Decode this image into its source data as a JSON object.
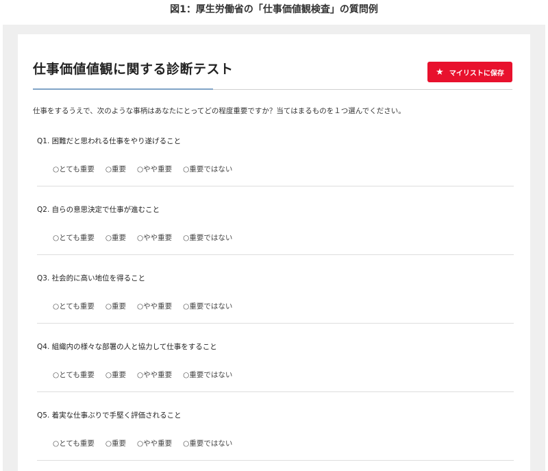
{
  "caption": "図1：厚生労働省の「仕事価値観検査」の質問例",
  "header": {
    "title": "仕事価値値観に関する診断テスト",
    "mylist_button_label": "マイリストに保存",
    "mylist_icon": "star-icon"
  },
  "intro": "仕事をするうえで、次のような事柄はあなたにとってどの程度重要ですか？当てはまるものを１つ選んでください。",
  "options": [
    "○とても重要",
    "○重要",
    "○やや重要",
    "○重要ではない"
  ],
  "questions": [
    {
      "text": "Q1. 困難だと思われる仕事をやり遂げること"
    },
    {
      "text": "Q2. 自らの意思決定で仕事が進むこと"
    },
    {
      "text": "Q3. 社会的に高い地位を得ること"
    },
    {
      "text": "Q4. 組織内の様々な部署の人と協力して仕事をすること"
    },
    {
      "text": "Q5. 着実な仕事ぶりで手堅く評価されること"
    }
  ],
  "colors": {
    "accent_button": "#e8112d",
    "title_underline_accent": "#7fa3c6"
  }
}
